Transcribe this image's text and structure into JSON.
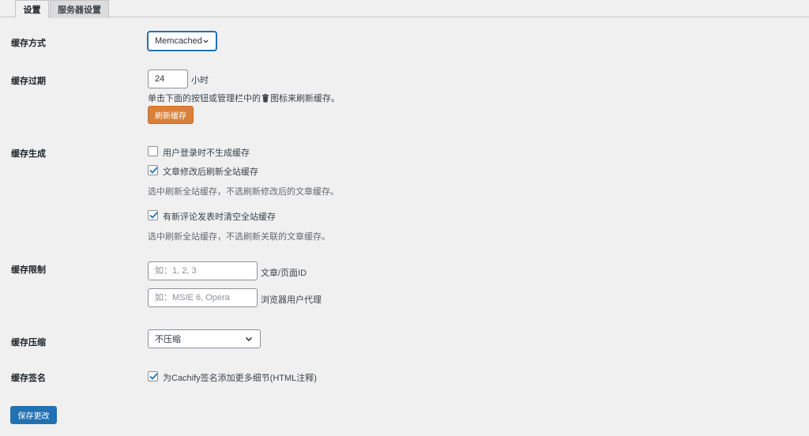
{
  "tabs": [
    {
      "label": "设置",
      "active": true
    },
    {
      "label": "服务器设置",
      "active": false
    }
  ],
  "cache_method": {
    "label": "缓存方式",
    "selected": "Memcached"
  },
  "cache_expiry": {
    "label": "缓存过期",
    "value": "24",
    "unit": "小时",
    "help_before": "单击下面的按钮或管理栏中的",
    "help_icon": "trash-icon",
    "help_after": "图标来刷新缓存。",
    "flush_button": "刷新缓存"
  },
  "cache_generation": {
    "label": "缓存生成",
    "options": [
      {
        "label": "用户登录时不生成缓存",
        "checked": false
      },
      {
        "label": "文章修改后刷新全站缓存",
        "checked": true,
        "desc": "选中刷新全站缓存，不选刷新修改后的文章缓存。"
      },
      {
        "label": "有新评论发表时清空全站缓存",
        "checked": true,
        "desc": "选中刷新全站缓存，不选刷新关联的文章缓存。"
      }
    ]
  },
  "cache_limits": {
    "label": "缓存限制",
    "post_ids": {
      "placeholder": "如：1, 2, 3",
      "suffix": "文章/页面ID"
    },
    "user_agents": {
      "placeholder": "如：MSIE 6, Opera",
      "suffix": "浏览器用户代理"
    }
  },
  "cache_compression": {
    "label": "缓存压缩",
    "selected": "不压缩"
  },
  "cache_signature": {
    "label": "缓存签名",
    "option": {
      "label": "为Cachify签名添加更多细节(HTML注释)",
      "checked": true
    }
  },
  "save_button": "保存更改",
  "colors": {
    "background": "#f0f0f1",
    "primary": "#2271b1",
    "flush": "#d98039"
  }
}
